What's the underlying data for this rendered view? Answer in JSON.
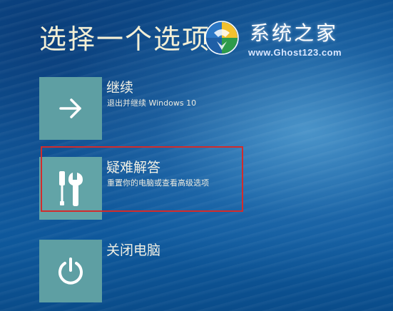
{
  "title": "选择一个选项",
  "watermark": {
    "name": "系统之家",
    "url": "www.Ghost123.com"
  },
  "options": [
    {
      "title": "继续",
      "subtitle": "退出并继续 Windows 10",
      "icon": "arrow-right-icon"
    },
    {
      "title": "疑难解答",
      "subtitle": "重置你的电脑或查看高级选项",
      "icon": "tools-icon",
      "highlighted": true
    },
    {
      "title": "关闭电脑",
      "subtitle": "",
      "icon": "power-icon"
    }
  ],
  "colors": {
    "background": "#1461a6",
    "tile": "#5e9fa3",
    "text": "#f1f0e4",
    "highlight_border": "#d22b2b"
  }
}
